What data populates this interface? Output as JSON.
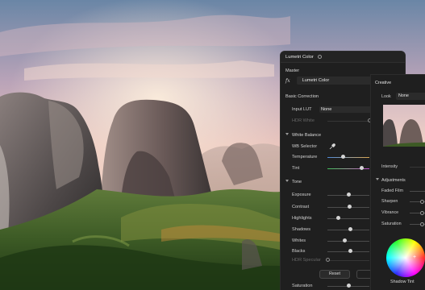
{
  "lumetri": {
    "title": "Lumetri Color",
    "master_label": "Master",
    "fx_symbol": "fx",
    "effect_name": "Lumetri Color",
    "basic_correction": "Basic Correction",
    "input_lut_label": "Input LUT",
    "input_lut_value": "None",
    "hdr_white_label": "HDR White",
    "white_balance_label": "White Balance",
    "wb_selector_label": "WB Selector",
    "temperature_label": "Temperature",
    "temperature_level": 0.38,
    "tint_label": "Tint",
    "tint_level": 0.82,
    "tone_label": "Tone",
    "tone_items": [
      {
        "label": "Exposure",
        "level": 0.5
      },
      {
        "label": "Contrast",
        "level": 0.52
      },
      {
        "label": "Highlights",
        "level": 0.25
      },
      {
        "label": "Shadows",
        "level": 0.55
      },
      {
        "label": "Whites",
        "level": 0.42
      },
      {
        "label": "Blacks",
        "level": 0.54
      }
    ],
    "hdr_specular_label": "HDR Specular",
    "reset_label": "Reset",
    "saturation_label": "Saturation"
  },
  "creative": {
    "title": "Creative",
    "look_label": "Look",
    "look_value": "None",
    "intensity_label": "Intensity",
    "adjustments_label": "Adjustments",
    "adjust_items": [
      {
        "label": "Faded Film",
        "level": 0.95
      },
      {
        "label": "Sharpen",
        "level": 0.5
      },
      {
        "label": "Vibrance",
        "level": 0.5
      },
      {
        "label": "Saturation",
        "level": 0.5
      }
    ],
    "wheel_label": "Shadow Tint",
    "wheel_marker": "+"
  },
  "icons": [
    "panel-menu-icon",
    "eyedropper-icon",
    "section-collapse-icon",
    "color-wheel-icon"
  ]
}
